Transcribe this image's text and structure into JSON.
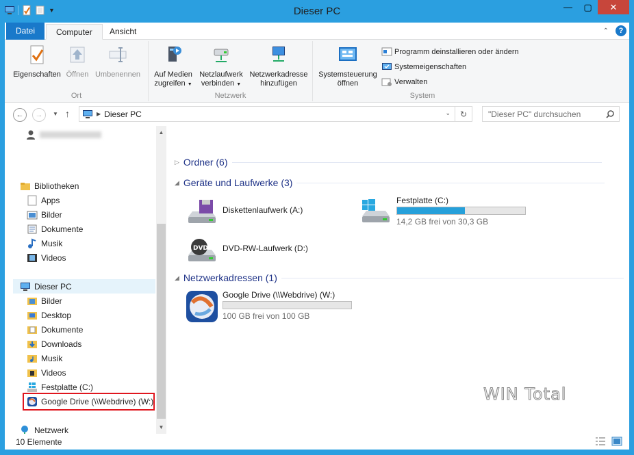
{
  "window": {
    "title": "Dieser PC"
  },
  "ribbon": {
    "tabs": [
      "Datei",
      "Computer",
      "Ansicht"
    ],
    "groups": {
      "ort": {
        "label": "Ort",
        "buttons": [
          "Eigenschaften",
          "Öffnen",
          "Umbenennen"
        ]
      },
      "netzwerk": {
        "label": "Netzwerk",
        "buttons": [
          {
            "line1": "Auf Medien",
            "line2": "zugreifen"
          },
          {
            "line1": "Netzlaufwerk",
            "line2": "verbinden"
          },
          {
            "line1": "Netzwerkadresse",
            "line2": "hinzufügen"
          }
        ]
      },
      "system": {
        "label": "System",
        "big": {
          "line1": "Systemsteuerung",
          "line2": "öffnen"
        },
        "small": [
          "Programm deinstallieren oder ändern",
          "Systemeigenschaften",
          "Verwalten"
        ]
      }
    }
  },
  "address": {
    "path": "Dieser PC",
    "search_placeholder": "\"Dieser PC\" durchsuchen"
  },
  "navpane": {
    "bibliotheken": "Bibliotheken",
    "libraries": [
      "Apps",
      "Bilder",
      "Dokumente",
      "Musik",
      "Videos"
    ],
    "this_pc": "Dieser PC",
    "pc_items": [
      "Bilder",
      "Desktop",
      "Dokumente",
      "Downloads",
      "Musik",
      "Videos",
      "Festplatte (C:)",
      "Google Drive (\\\\Webdrive) (W:)"
    ],
    "network": "Netzwerk"
  },
  "content": {
    "groups": {
      "ordner": "Ordner (6)",
      "geraete": "Geräte und Laufwerke (3)",
      "netz": "Netzwerkadressen (1)"
    },
    "drives": {
      "floppy": {
        "name": "Diskettenlaufwerk (A:)"
      },
      "c": {
        "name": "Festplatte (C:)",
        "free": "14,2 GB frei von 30,3 GB",
        "used_fraction": 0.53
      },
      "dvd": {
        "name": "DVD-RW-Laufwerk (D:)"
      },
      "gdrive": {
        "name": "Google Drive (\\\\Webdrive) (W:)",
        "free": "100 GB frei von 100 GB",
        "used_fraction": 0.0
      }
    }
  },
  "status": {
    "count": "10 Elemente"
  },
  "watermark": "WIN Total",
  "colors": {
    "titlebar": "#2b9fe0",
    "file_tab": "#1979ca",
    "highlight": "#e0161e",
    "bar_fill": "#26a0da"
  }
}
